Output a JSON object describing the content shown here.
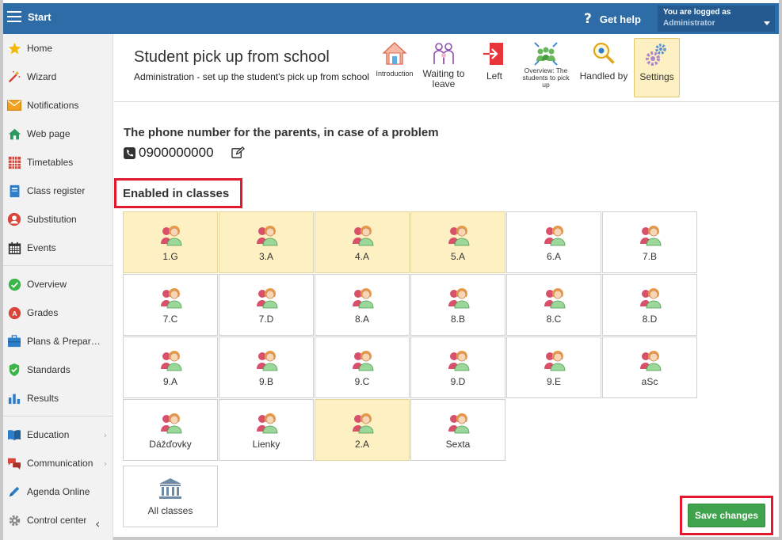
{
  "topbar": {
    "start_label": "Start",
    "help_label": "Get help",
    "logged_as": "You are logged as",
    "user_role": "Administrator"
  },
  "sidebar": {
    "items": [
      {
        "label": "Home",
        "icon": "star-icon"
      },
      {
        "label": "Wizard",
        "icon": "magic-wand-icon"
      },
      {
        "label": "Notifications",
        "icon": "envelope-icon"
      },
      {
        "label": "Web page",
        "icon": "house-icon"
      },
      {
        "label": "Timetables",
        "icon": "timetable-grid-icon"
      },
      {
        "label": "Class register",
        "icon": "notebook-icon"
      },
      {
        "label": "Substitution",
        "icon": "person-circle-icon"
      },
      {
        "label": "Events",
        "icon": "calendar-icon"
      },
      {
        "label": "Overview",
        "icon": "green-check-icon"
      },
      {
        "label": "Grades",
        "icon": "grade-badge-icon"
      },
      {
        "label": "Plans & Prepar…",
        "icon": "briefcase-icon"
      },
      {
        "label": "Standards",
        "icon": "shield-check-icon"
      },
      {
        "label": "Results",
        "icon": "bar-chart-icon"
      },
      {
        "label": "Education",
        "icon": "book-icon"
      },
      {
        "label": "Communication",
        "icon": "chat-bubbles-icon"
      },
      {
        "label": "Agenda Online",
        "icon": "pen-icon"
      },
      {
        "label": "Control center",
        "icon": "gear-icon"
      }
    ]
  },
  "header": {
    "title": "Student pick up from school",
    "subtitle": "Administration - set up the student's pick up from school",
    "tools": [
      {
        "label": "Introduction"
      },
      {
        "label": "Waiting to leave"
      },
      {
        "label": "Left"
      },
      {
        "label": "Overview: The students to pick up"
      },
      {
        "label": "Handled by"
      },
      {
        "label": "Settings"
      }
    ]
  },
  "phone": {
    "heading": "The phone number for the parents, in case of a problem",
    "number": "0900000000"
  },
  "classes": {
    "heading": "Enabled in classes",
    "items": [
      {
        "name": "1.G",
        "enabled": true
      },
      {
        "name": "3.A",
        "enabled": true
      },
      {
        "name": "4.A",
        "enabled": true
      },
      {
        "name": "5.A",
        "enabled": true
      },
      {
        "name": "6.A",
        "enabled": false
      },
      {
        "name": "7.B",
        "enabled": false
      },
      {
        "name": "7.C",
        "enabled": false
      },
      {
        "name": "7.D",
        "enabled": false
      },
      {
        "name": "8.A",
        "enabled": false
      },
      {
        "name": "8.B",
        "enabled": false
      },
      {
        "name": "8.C",
        "enabled": false
      },
      {
        "name": "8.D",
        "enabled": false
      },
      {
        "name": "9.A",
        "enabled": false
      },
      {
        "name": "9.B",
        "enabled": false
      },
      {
        "name": "9.C",
        "enabled": false
      },
      {
        "name": "9.D",
        "enabled": false
      },
      {
        "name": "9.E",
        "enabled": false
      },
      {
        "name": "aSc",
        "enabled": false
      },
      {
        "name": "Dážďovky",
        "enabled": false
      },
      {
        "name": "Lienky",
        "enabled": false
      },
      {
        "name": "2.A",
        "enabled": true
      },
      {
        "name": "Sexta",
        "enabled": false
      }
    ],
    "all_label": "All classes"
  },
  "save_label": "Save changes",
  "colors": {
    "topbar": "#2e6ca8",
    "highlight": "#fdf0c2",
    "save": "#3fa34d",
    "annotation": "#e3172d"
  }
}
